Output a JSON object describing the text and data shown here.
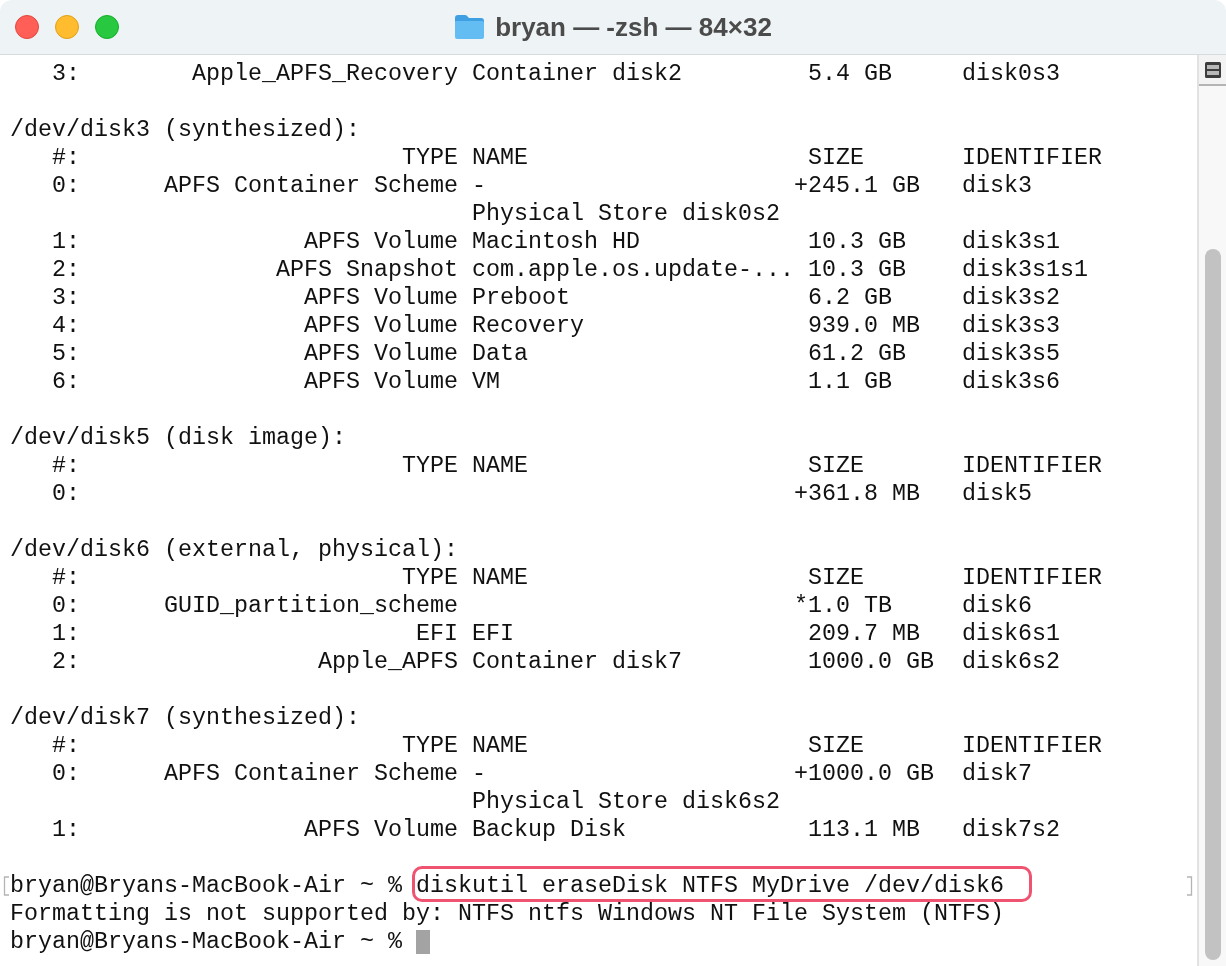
{
  "window": {
    "title": "bryan — -zsh — 84×32"
  },
  "terminal": {
    "top_row": {
      "index": "3:",
      "type": "Apple_APFS_Recovery",
      "name": "Container disk2",
      "size": "5.4 GB",
      "identifier": "disk0s3"
    },
    "disks": [
      {
        "header": "/dev/disk3 (synthesized):",
        "columns": {
          "index": "#:",
          "type": "TYPE",
          "name": "NAME",
          "size": "SIZE",
          "identifier": "IDENTIFIER"
        },
        "rows": [
          {
            "index": "0:",
            "type": "APFS Container Scheme",
            "name": "-",
            "detail": "Physical Store disk0s2",
            "size_flag": "+",
            "size": "245.1 GB",
            "identifier": "disk3"
          },
          {
            "index": "1:",
            "type": "APFS Volume",
            "name": "Macintosh HD",
            "size": "10.3 GB",
            "identifier": "disk3s1"
          },
          {
            "index": "2:",
            "type": "APFS Snapshot",
            "name": "com.apple.os.update-...",
            "size": "10.3 GB",
            "identifier": "disk3s1s1"
          },
          {
            "index": "3:",
            "type": "APFS Volume",
            "name": "Preboot",
            "size": "6.2 GB",
            "identifier": "disk3s2"
          },
          {
            "index": "4:",
            "type": "APFS Volume",
            "name": "Recovery",
            "size": "939.0 MB",
            "identifier": "disk3s3"
          },
          {
            "index": "5:",
            "type": "APFS Volume",
            "name": "Data",
            "size": "61.2 GB",
            "identifier": "disk3s5"
          },
          {
            "index": "6:",
            "type": "APFS Volume",
            "name": "VM",
            "size": "1.1 GB",
            "identifier": "disk3s6"
          }
        ]
      },
      {
        "header": "/dev/disk5 (disk image):",
        "columns": {
          "index": "#:",
          "type": "TYPE",
          "name": "NAME",
          "size": "SIZE",
          "identifier": "IDENTIFIER"
        },
        "rows": [
          {
            "index": "0:",
            "size_flag": "+",
            "size": "361.8 MB",
            "identifier": "disk5"
          }
        ]
      },
      {
        "header": "/dev/disk6 (external, physical):",
        "columns": {
          "index": "#:",
          "type": "TYPE",
          "name": "NAME",
          "size": "SIZE",
          "identifier": "IDENTIFIER"
        },
        "rows": [
          {
            "index": "0:",
            "type": "GUID_partition_scheme",
            "size_flag": "*",
            "size": "1.0 TB",
            "identifier": "disk6"
          },
          {
            "index": "1:",
            "type": "EFI",
            "name": "EFI",
            "size": "209.7 MB",
            "identifier": "disk6s1"
          },
          {
            "index": "2:",
            "type": "Apple_APFS",
            "name": "Container disk7",
            "size": "1000.0 GB",
            "identifier": "disk6s2"
          }
        ]
      },
      {
        "header": "/dev/disk7 (synthesized):",
        "columns": {
          "index": "#:",
          "type": "TYPE",
          "name": "NAME",
          "size": "SIZE",
          "identifier": "IDENTIFIER"
        },
        "rows": [
          {
            "index": "0:",
            "type": "APFS Container Scheme",
            "name": "-",
            "detail": "Physical Store disk6s2",
            "size_flag": "+",
            "size": "1000.0 GB",
            "identifier": "disk7"
          },
          {
            "index": "1:",
            "type": "APFS Volume",
            "name": "Backup Disk",
            "size": "113.1 MB",
            "identifier": "disk7s2"
          }
        ]
      }
    ],
    "session": [
      {
        "kind": "prompt",
        "prompt": "bryan@Bryans-MacBook-Air ~ %",
        "command": "diskutil eraseDisk NTFS MyDrive /dev/disk6",
        "marked": true,
        "highlighted": true,
        "cursor": false
      },
      {
        "kind": "output",
        "text": "Formatting is not supported by: NTFS ntfs Windows NT File System (NTFS)",
        "marked": false,
        "highlighted": false,
        "cursor": false
      },
      {
        "kind": "prompt",
        "prompt": "bryan@Bryans-MacBook-Air ~ %",
        "marked": false,
        "highlighted": false,
        "cursor": true
      }
    ]
  }
}
